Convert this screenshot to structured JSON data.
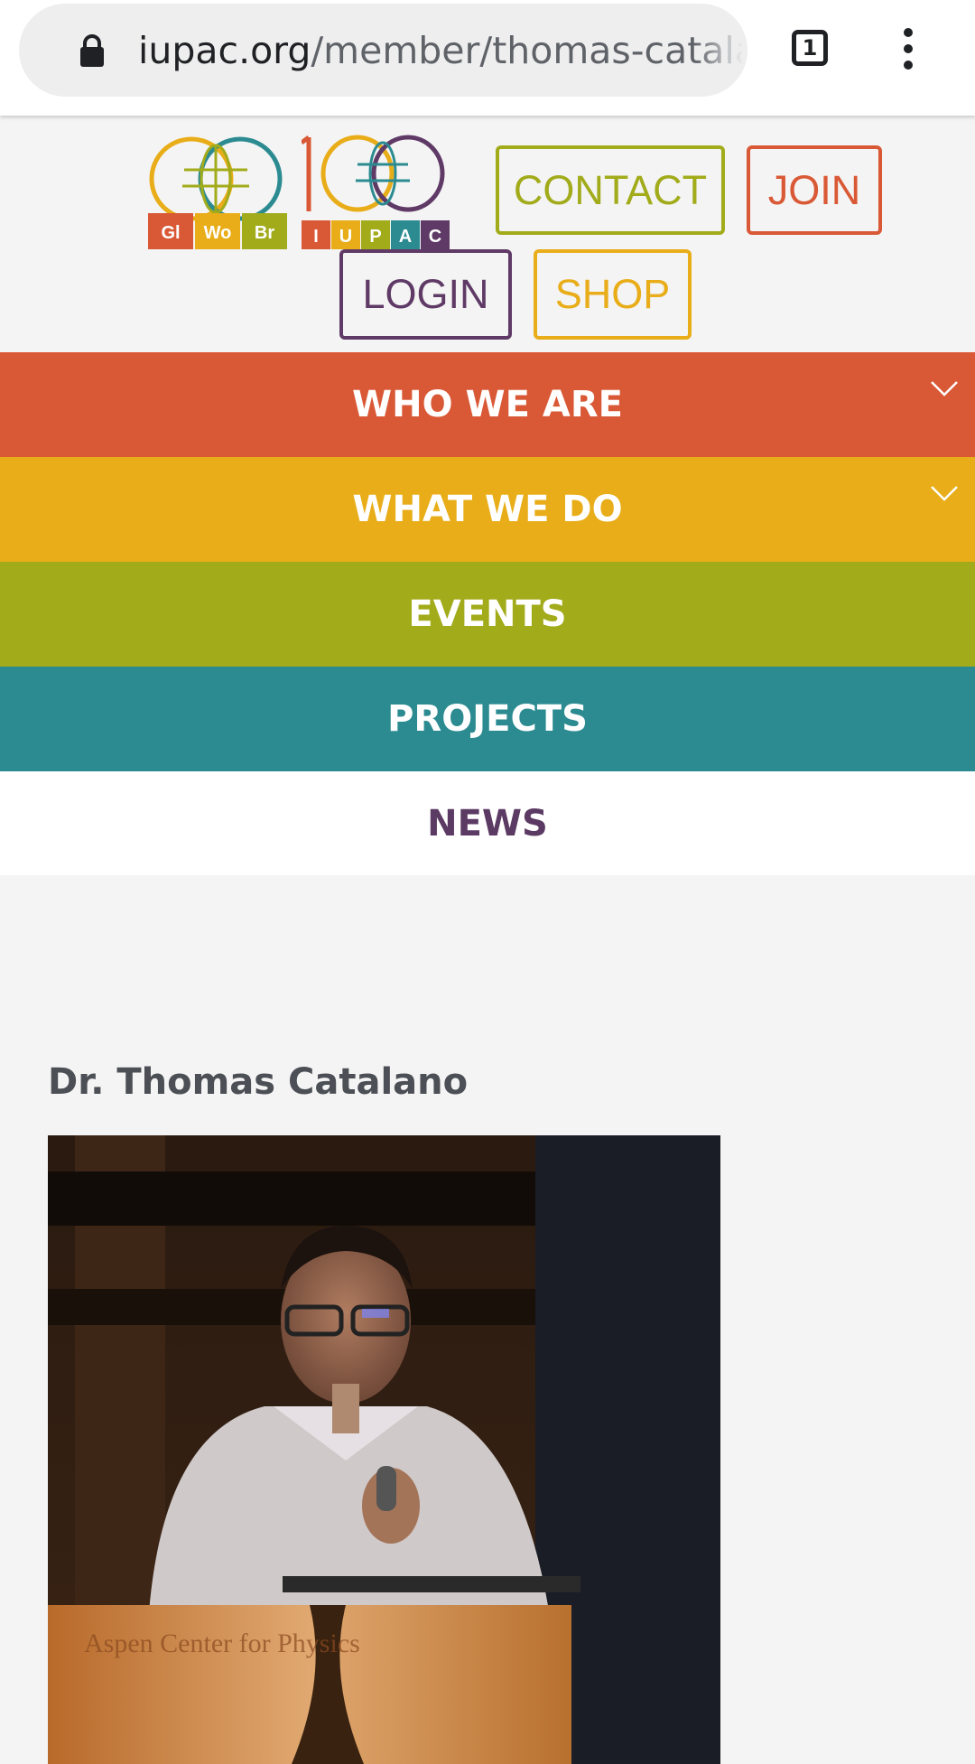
{
  "browser": {
    "url_host": "iupac.org",
    "url_path": "/member/thomas-catalano/",
    "tab_count": "1"
  },
  "header": {
    "logos": {
      "gwb_letters": [
        "Gl",
        "Wo",
        "Br"
      ],
      "centennial_number": "100",
      "iupac_letters": [
        "I",
        "U",
        "P",
        "A",
        "C"
      ]
    },
    "buttons": {
      "contact": "CONTACT",
      "join": "JOIN",
      "login": "LOGIN",
      "shop": "SHOP"
    }
  },
  "nav": {
    "items": [
      {
        "label": "WHO WE ARE",
        "color": "#d95835",
        "has_dropdown": true
      },
      {
        "label": "WHAT WE DO",
        "color": "#e8ad18",
        "has_dropdown": true
      },
      {
        "label": "EVENTS",
        "color": "#a2ab1a",
        "has_dropdown": false
      },
      {
        "label": "PROJECTS",
        "color": "#2b8b91",
        "has_dropdown": false
      },
      {
        "label": "NEWS",
        "color": "#ffffff",
        "has_dropdown": false
      }
    ]
  },
  "main": {
    "title": "Dr. Thomas Catalano",
    "photo": {
      "podium_text": "Aspen Center for Physics"
    }
  },
  "colors": {
    "orange": "#d95835",
    "yellow": "#e8ad18",
    "green": "#a2ab1a",
    "teal": "#2b8b91",
    "purple": "#5f3a66",
    "title_gray": "#4c4f55"
  }
}
